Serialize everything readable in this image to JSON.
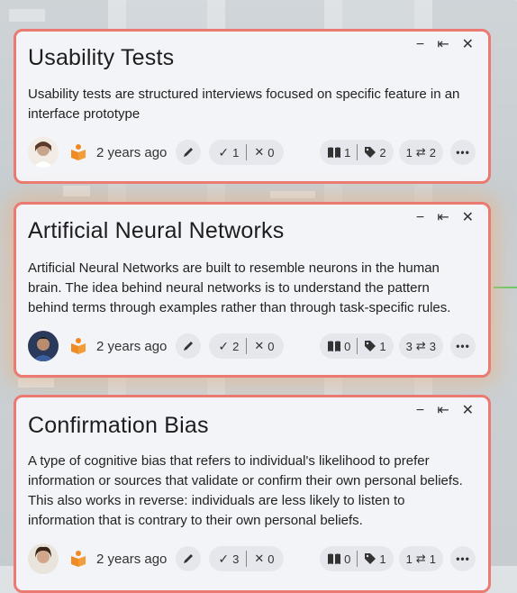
{
  "cards": [
    {
      "title": "Usability Tests",
      "description": "Usability tests are structured interviews focused on specific feature in an interface prototype",
      "age": "2 years ago",
      "upvotes": "1",
      "downvotes": "0",
      "sources": "1",
      "tags": "2",
      "links_in": "1",
      "links_out": "2"
    },
    {
      "title": "Artificial Neural Networks",
      "description": "Artificial Neural Networks are built to resemble neurons in the human brain. The idea behind neural networks is to understand the pattern behind terms through examples rather than through task-specific rules.",
      "age": "2 years ago",
      "upvotes": "2",
      "downvotes": "0",
      "sources": "0",
      "tags": "1",
      "links_in": "3",
      "links_out": "3"
    },
    {
      "title": "Confirmation Bias",
      "description": "A type of cognitive bias that refers to individual's likelihood to prefer information or sources that validate or confirm their own personal beliefs. This also works in reverse: individuals are less likely to listen to information that is contrary to their own personal beliefs.",
      "age": "2 years ago",
      "upvotes": "3",
      "downvotes": "0",
      "sources": "0",
      "tags": "1",
      "links_in": "1",
      "links_out": "1"
    }
  ],
  "window_controls": {
    "minimize": "−",
    "collapse": "⇤",
    "close": "✕"
  },
  "colors": {
    "card_border": "#ea7a72",
    "card_bg": "#f3f4f8",
    "book_icon": "#f08a24"
  }
}
